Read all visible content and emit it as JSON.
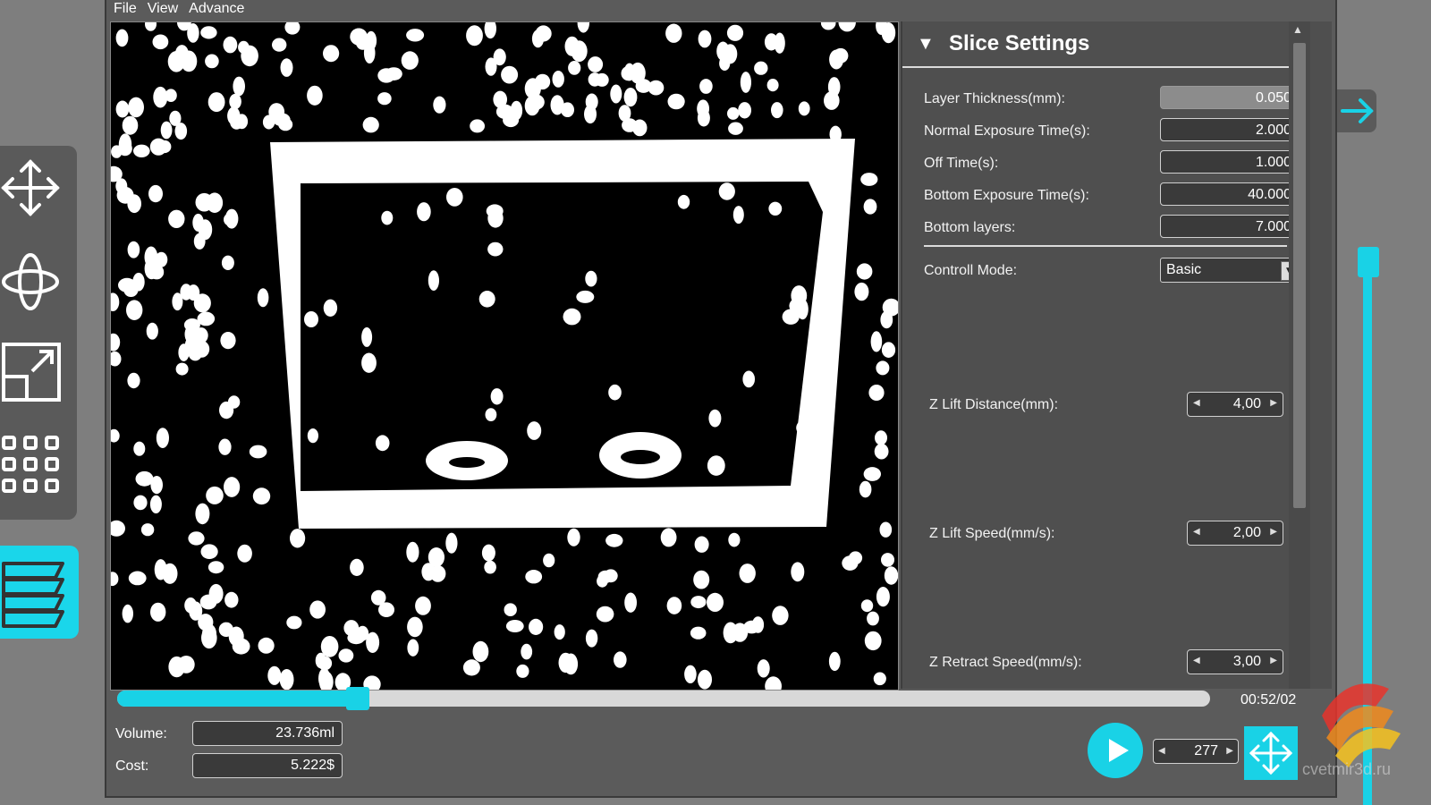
{
  "menu": [
    "File",
    "View",
    "Advance"
  ],
  "panel": {
    "title": "Slice Settings",
    "fields": [
      {
        "label": "Layer Thickness(mm):",
        "value": "0.050",
        "disabled": true
      },
      {
        "label": "Normal Exposure Time(s):",
        "value": "2.000"
      },
      {
        "label": "Off Time(s):",
        "value": "1.000"
      },
      {
        "label": "Bottom Exposure Time(s):",
        "value": "40.000"
      },
      {
        "label": "Bottom layers:",
        "value": "7.000"
      }
    ],
    "control_mode": {
      "label": "Controll Mode:",
      "value": "Basic"
    },
    "spinners": [
      {
        "label": "Z Lift Distance(mm):",
        "value": "4,00"
      },
      {
        "label": "Z Lift Speed(mm/s):",
        "value": "2,00"
      },
      {
        "label": "Z Retract Speed(mm/s):",
        "value": "3,00"
      }
    ]
  },
  "bottom": {
    "time": "00:52/02",
    "volume_label": "Volume:",
    "volume_value": "23.736ml",
    "cost_label": "Cost:",
    "cost_value": "5.222$",
    "layer": "277",
    "progress": 0.22
  },
  "icons": {
    "move": "move-icon",
    "rotate": "rotate-icon",
    "scale": "scale-icon",
    "grid": "grid-icon",
    "layers": "layers-icon",
    "play": "play-icon",
    "arrow": "arrow-right-icon"
  },
  "accent_color": "#19d2e6",
  "watermark": "cvetmir3d.ru"
}
